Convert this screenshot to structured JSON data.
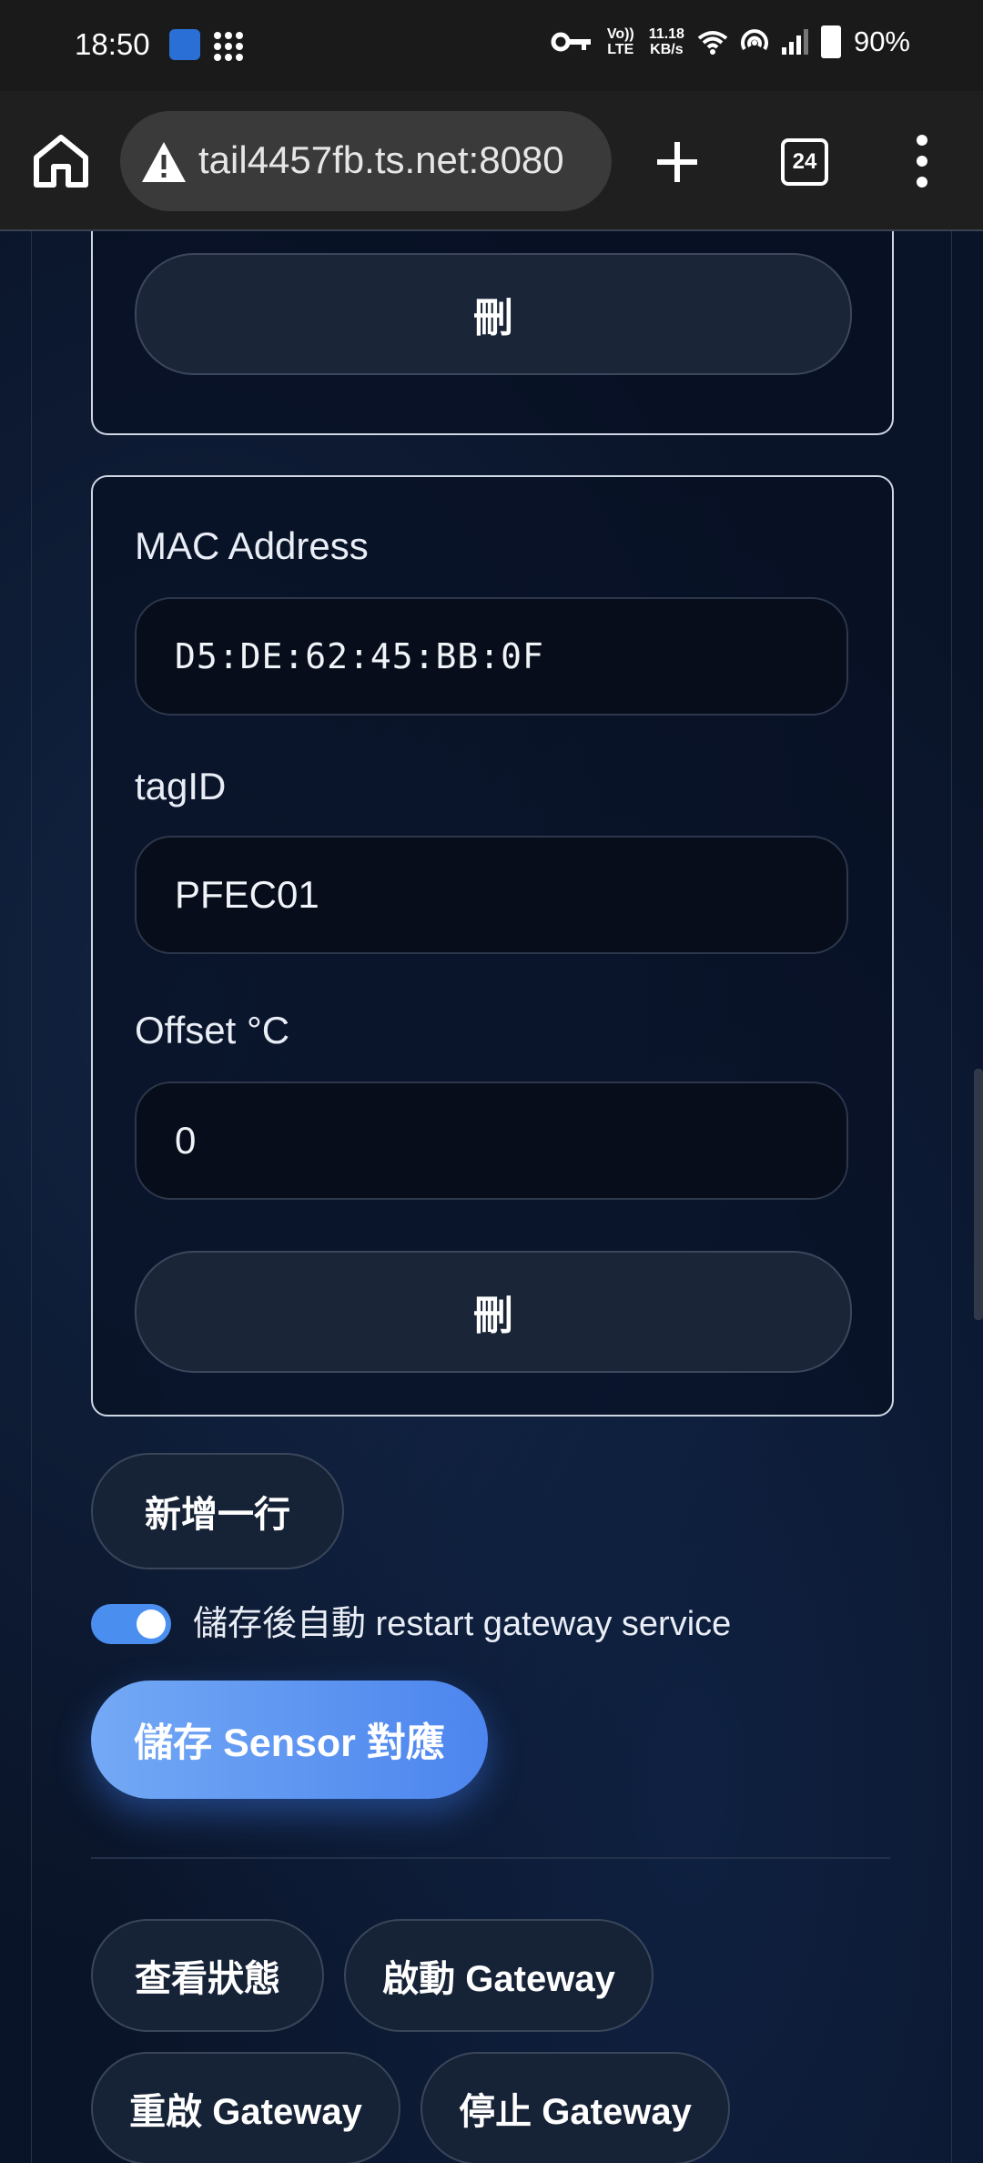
{
  "status_bar": {
    "time": "18:50",
    "network_speed": "11.18",
    "network_unit": "KB/s",
    "volte": "Vo)) LTE",
    "battery": "90%",
    "icons": [
      "app-icon",
      "grid-dots-icon",
      "vpn-key-icon",
      "volte-icon",
      "wifi-icon",
      "hotspot-icon",
      "signal-icon",
      "battery-icon"
    ]
  },
  "browser": {
    "url": "tail4457fb.ts.net:8080",
    "tab_count": "24",
    "icons": [
      "home-icon",
      "warning-icon",
      "plus-icon",
      "tabs-icon",
      "more-vert-icon"
    ]
  },
  "previous_card": {
    "delete_label": "刪"
  },
  "sensor_card": {
    "mac_label": "MAC Address",
    "mac_value": "D5:DE:62:45:BB:0F",
    "tag_label": "tagID",
    "tag_value": "PFEC01",
    "offset_label": "Offset °C",
    "offset_value": "0",
    "delete_label": "刪"
  },
  "actions": {
    "add_row_label": "新增一行",
    "auto_restart_label": "儲存後自動 restart gateway service",
    "auto_restart_on": true,
    "save_label": "儲存 Sensor 對應",
    "view_status_label": "查看狀態",
    "start_label": "啟動 Gateway",
    "restart_label": "重啟 Gateway",
    "stop_label": "停止 Gateway"
  },
  "colors": {
    "accent": "#4c85ee",
    "background": "#0a1428"
  }
}
